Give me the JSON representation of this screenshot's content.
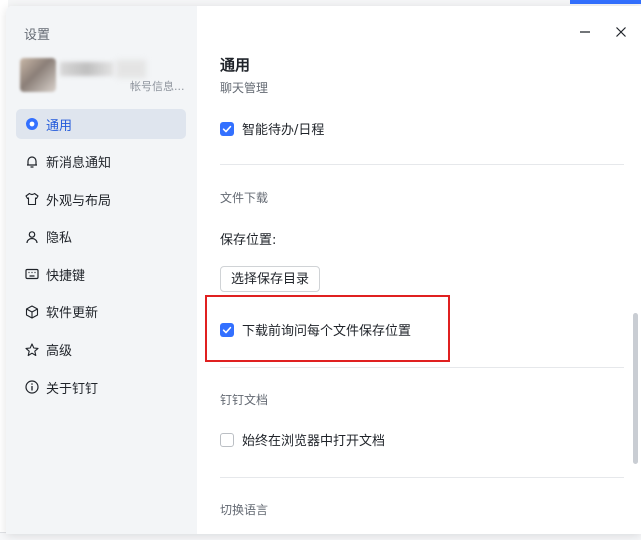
{
  "window": {
    "title": "设置"
  },
  "account": {
    "info": "帐号信息..."
  },
  "sidebar": {
    "items": [
      {
        "label": "通用",
        "icon": "general-icon",
        "active": true
      },
      {
        "label": "新消息通知",
        "icon": "bell-icon",
        "active": false
      },
      {
        "label": "外观与布局",
        "icon": "shirt-icon",
        "active": false
      },
      {
        "label": "隐私",
        "icon": "person-icon",
        "active": false
      },
      {
        "label": "快捷键",
        "icon": "keyboard-icon",
        "active": false
      },
      {
        "label": "软件更新",
        "icon": "cube-icon",
        "active": false
      },
      {
        "label": "高级",
        "icon": "star-icon",
        "active": false
      },
      {
        "label": "关于钉钉",
        "icon": "info-icon",
        "active": false
      }
    ]
  },
  "content": {
    "section_title": "通用",
    "chat_manage_label": "聊天管理",
    "smart_todo": {
      "label": "智能待办/日程",
      "checked": true
    },
    "file_download": {
      "title": "文件下载",
      "save_location_label": "保存位置:",
      "select_dir_button": "选择保存目录",
      "ask_each_time": {
        "label": "下载前询问每个文件保存位置",
        "checked": true
      }
    },
    "dingtalk_docs": {
      "title": "钉钉文档",
      "open_in_browser": {
        "label": "始终在浏览器中打开文档",
        "checked": false
      }
    },
    "language": {
      "title": "切换语言"
    }
  },
  "colors": {
    "accent": "#3370ff",
    "highlight": "#e02020",
    "sidebar_bg": "#f3f5f7"
  }
}
